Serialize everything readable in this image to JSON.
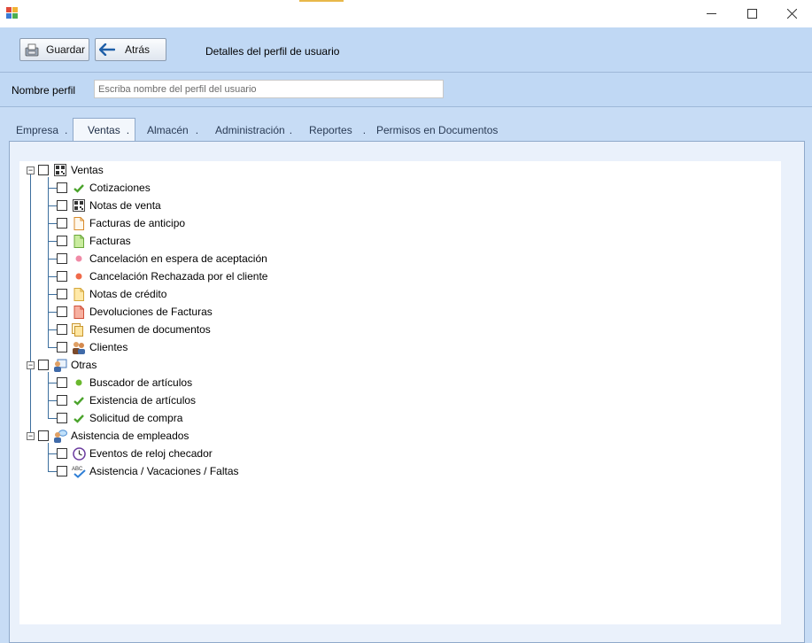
{
  "toolbar": {
    "save_label": "Guardar",
    "back_label": "Atrás",
    "title": "Detalles del perfil de usuario"
  },
  "profile": {
    "label": "Nombre perfil",
    "placeholder": "Escriba nombre del perfil del usuario",
    "value": ""
  },
  "tabs": [
    {
      "label": "Empresa",
      "suffix": "."
    },
    {
      "label": "Ventas",
      "suffix": "."
    },
    {
      "label": "Almacén",
      "suffix": "."
    },
    {
      "label": "Administración",
      "suffix": "."
    },
    {
      "label": "Reportes",
      "suffix": "."
    },
    {
      "label": "Permisos en Documentos",
      "suffix": ""
    }
  ],
  "active_tab": "Ventas",
  "tree": {
    "groups": [
      {
        "label": "Ventas",
        "icon": "qr-grid-icon",
        "expanded": true,
        "items": [
          {
            "label": "Cotizaciones",
            "icon": "green-check-icon"
          },
          {
            "label": "Notas de venta",
            "icon": "qr-grid-icon"
          },
          {
            "label": "Facturas de anticipo",
            "icon": "document-orange-icon"
          },
          {
            "label": "Facturas",
            "icon": "document-green-icon"
          },
          {
            "label": "Cancelación en espera de aceptación",
            "icon": "pink-dot-icon"
          },
          {
            "label": "Cancelación Rechazada por el cliente",
            "icon": "red-dot-icon"
          },
          {
            "label": "Notas de crédito",
            "icon": "document-yellow-icon"
          },
          {
            "label": "Devoluciones de Facturas",
            "icon": "document-red-icon"
          },
          {
            "label": "Resumen de documentos",
            "icon": "documents-stack-icon"
          },
          {
            "label": "Clientes",
            "icon": "people-icon"
          }
        ]
      },
      {
        "label": "Otras",
        "icon": "user-card-icon",
        "expanded": true,
        "items": [
          {
            "label": "Buscador de artículos",
            "icon": "green-dot-icon"
          },
          {
            "label": "Existencia de artículos",
            "icon": "green-check-icon"
          },
          {
            "label": "Solicitud de compra",
            "icon": "green-check-icon"
          }
        ]
      },
      {
        "label": "Asistencia de empleados",
        "icon": "user-chat-icon",
        "expanded": true,
        "items": [
          {
            "label": "Eventos de reloj checador",
            "icon": "clock-icon"
          },
          {
            "label": "Asistencia / Vacaciones / Faltas",
            "icon": "abc-check-icon"
          }
        ]
      }
    ]
  },
  "colors": {
    "background": "#c7dcf5",
    "tree_line": "#3d6f9e",
    "tab_border": "#8fa9ca"
  }
}
